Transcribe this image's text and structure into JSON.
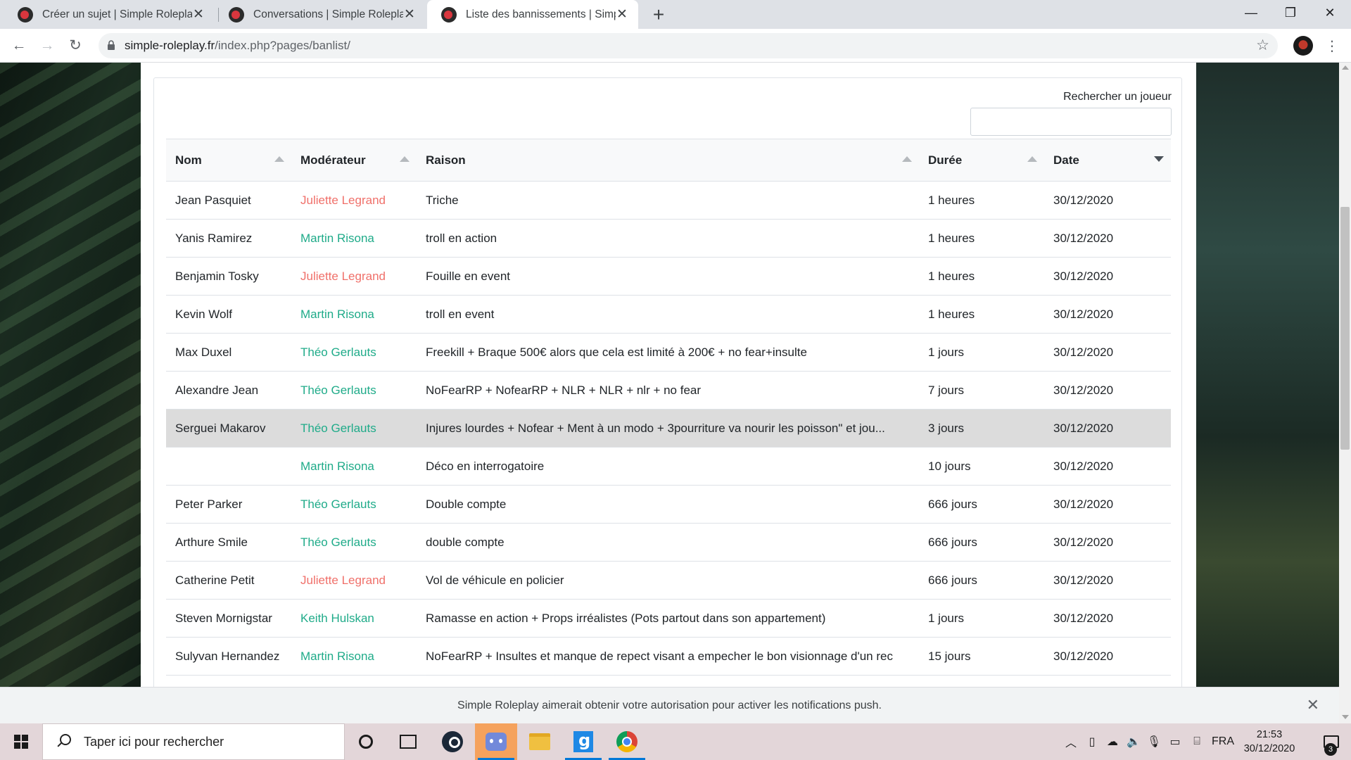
{
  "browser": {
    "tabs": [
      {
        "title": "Créer un sujet | Simple Roleplay",
        "active": false
      },
      {
        "title": "Conversations | Simple Roleplay",
        "active": false
      },
      {
        "title": "Liste des bannissements | Simple",
        "active": true
      }
    ],
    "url_host": "simple-roleplay.fr",
    "url_path": "/index.php?pages/banlist/"
  },
  "page": {
    "search_label": "Rechercher un joueur",
    "search_value": "",
    "columns": [
      "Nom",
      "Modérateur",
      "Raison",
      "Durée",
      "Date"
    ],
    "sorted_column": "Date",
    "rows": [
      {
        "nom": "Jean Pasquiet",
        "moderateur": "Juliette Legrand",
        "raison": "Triche",
        "duree": "1 heures",
        "date": "30/12/2020"
      },
      {
        "nom": "Yanis Ramirez",
        "moderateur": "Martin Risona",
        "raison": "troll en action",
        "duree": "1 heures",
        "date": "30/12/2020"
      },
      {
        "nom": "Benjamin Tosky",
        "moderateur": "Juliette Legrand",
        "raison": "Fouille en event",
        "duree": "1 heures",
        "date": "30/12/2020"
      },
      {
        "nom": "Kevin Wolf",
        "moderateur": "Martin Risona",
        "raison": "troll en event",
        "duree": "1 heures",
        "date": "30/12/2020"
      },
      {
        "nom": "Max Duxel",
        "moderateur": "Théo Gerlauts",
        "raison": "Freekill + Braque 500€ alors que cela est limité à 200€ + no fear+insulte",
        "duree": "1 jours",
        "date": "30/12/2020"
      },
      {
        "nom": "Alexandre Jean",
        "moderateur": "Théo Gerlauts",
        "raison": "NoFearRP + NofearRP + NLR + NLR + nlr + no fear",
        "duree": "7 jours",
        "date": "30/12/2020"
      },
      {
        "nom": "Serguei Makarov",
        "moderateur": "Théo Gerlauts",
        "raison": "Injures lourdes + Nofear + Ment à un modo + 3pourriture va nourir les poisson\" et jou...",
        "duree": "3 jours",
        "date": "30/12/2020"
      },
      {
        "nom": "",
        "moderateur": "Martin Risona",
        "raison": "Déco en interrogatoire",
        "duree": "10 jours",
        "date": "30/12/2020"
      },
      {
        "nom": "Peter Parker",
        "moderateur": "Théo Gerlauts",
        "raison": "Double compte",
        "duree": "666 jours",
        "date": "30/12/2020"
      },
      {
        "nom": "Arthure Smile",
        "moderateur": "Théo Gerlauts",
        "raison": "double compte",
        "duree": "666 jours",
        "date": "30/12/2020"
      },
      {
        "nom": "Catherine Petit",
        "moderateur": "Juliette Legrand",
        "raison": "Vol de véhicule en policier",
        "duree": "666 jours",
        "date": "30/12/2020"
      },
      {
        "nom": "Steven Mornigstar",
        "moderateur": "Keith Hulskan",
        "raison": "Ramasse en action + Props irréalistes (Pots partout dans son appartement)",
        "duree": "1 jours",
        "date": "30/12/2020"
      },
      {
        "nom": "Sulyvan Hernandez",
        "moderateur": "Martin Risona",
        "raison": "NoFearRP + Insultes et manque de repect visant a empecher le bon visionnage d'un rec",
        "duree": "15 jours",
        "date": "30/12/2020"
      }
    ],
    "moderator_colors": {
      "Juliette Legrand": "#f0706a",
      "Martin Risona": "#1fab89",
      "Théo Gerlauts": "#1fab89",
      "Keith Hulskan": "#1fab89"
    }
  },
  "notification": {
    "text": "Simple Roleplay aimerait obtenir votre autorisation pour activer les notifications push."
  },
  "taskbar": {
    "search_placeholder": "Taper ici pour rechercher",
    "language": "FRA",
    "time": "21:53",
    "date": "30/12/2020",
    "notification_count": "3"
  }
}
